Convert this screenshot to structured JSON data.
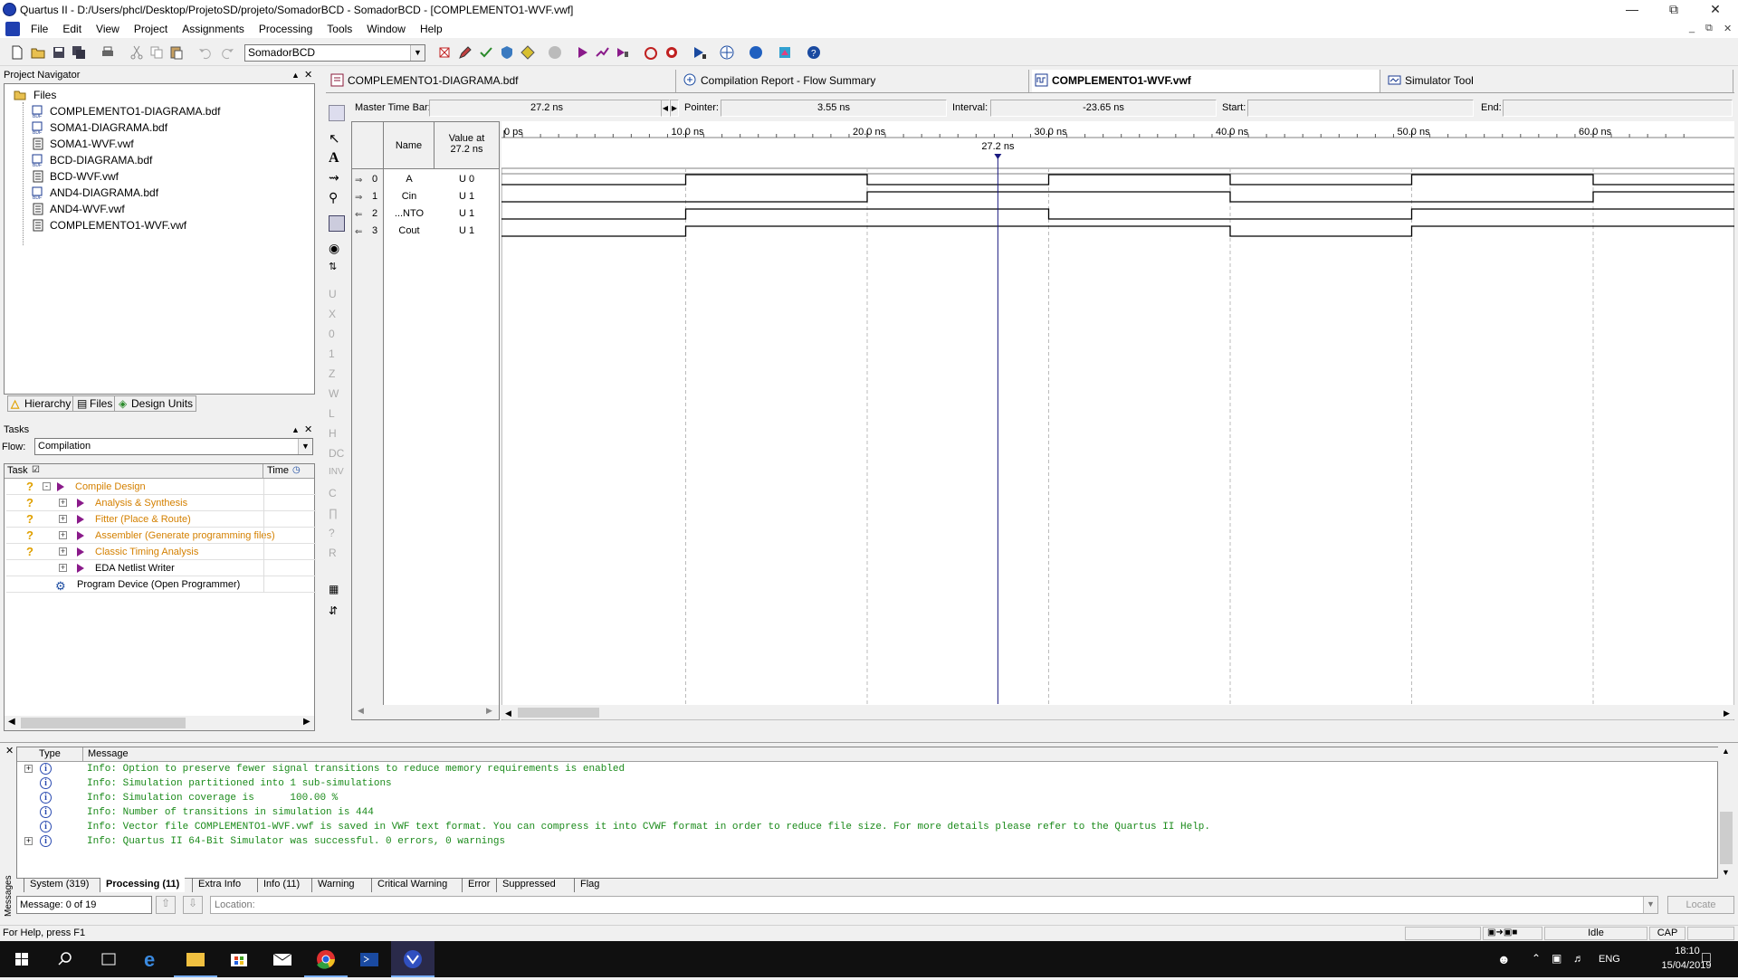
{
  "window": {
    "title": "Quartus II - D:/Users/phcl/Desktop/ProjetoSD/projeto/SomadorBCD - SomadorBCD - [COMPLEMENTO1-WVF.vwf]"
  },
  "menu": [
    "File",
    "Edit",
    "View",
    "Project",
    "Assignments",
    "Processing",
    "Tools",
    "Window",
    "Help"
  ],
  "toolbar": {
    "project_select": "SomadorBCD"
  },
  "project_navigator": {
    "title": "Project Navigator",
    "root": "Files",
    "files": [
      "COMPLEMENTO1-DIAGRAMA.bdf",
      "SOMA1-DIAGRAMA.bdf",
      "SOMA1-WVF.vwf",
      "BCD-DIAGRAMA.bdf",
      "BCD-WVF.vwf",
      "AND4-DIAGRAMA.bdf",
      "AND4-WVF.vwf",
      "COMPLEMENTO1-WVF.vwf"
    ],
    "tabs": [
      "Hierarchy",
      "Files",
      "Design Units"
    ]
  },
  "tasks": {
    "title": "Tasks",
    "flow_label": "Flow:",
    "flow_value": "Compilation",
    "col_task": "Task",
    "col_time": "Time",
    "rows": [
      "Compile Design",
      "Analysis & Synthesis",
      "Fitter (Place & Route)",
      "Assembler (Generate programming files)",
      "Classic Timing Analysis",
      "EDA Netlist Writer",
      "Program Device (Open Programmer)"
    ]
  },
  "doc_tabs": [
    "COMPLEMENTO1-DIAGRAMA.bdf",
    "Compilation Report - Flow Summary",
    "COMPLEMENTO1-WVF.vwf",
    "Simulator Tool"
  ],
  "waveform": {
    "master_label": "Master Time Bar:",
    "master_value": "27.2 ns",
    "pointer_label": "Pointer:",
    "pointer_value": "3.55 ns",
    "interval_label": "Interval:",
    "interval_value": "-23.65 ns",
    "start_label": "Start:",
    "end_label": "End:",
    "col_name": "Name",
    "col_value": "Value at",
    "col_value2": "27.2 ns",
    "cursor_label": "27.2 ns",
    "time_ticks": [
      "0 ps",
      "10.0 ns",
      "20.0 ns",
      "30.0 ns",
      "40.0 ns",
      "50.0 ns",
      "60.0 ns"
    ],
    "signals": [
      {
        "idx": "0",
        "name": "A",
        "value": "U 0",
        "transitions_ns": [
          0,
          10,
          20,
          30,
          40,
          50,
          60
        ],
        "start": 0
      },
      {
        "idx": "1",
        "name": "Cin",
        "value": "U 1",
        "transitions_ns": [
          0,
          20,
          40,
          60
        ],
        "start": 0
      },
      {
        "idx": "2",
        "name": "...NTO",
        "value": "U 1",
        "transitions_ns": [
          0,
          10,
          30,
          50
        ],
        "start": 0
      },
      {
        "idx": "3",
        "name": "Cout",
        "value": "U 1",
        "transitions_ns": [
          0,
          10,
          40,
          50
        ],
        "start": 0
      }
    ]
  },
  "messages": {
    "col_type": "Type",
    "col_message": "Message",
    "lines": [
      "Info: Option to preserve fewer signal transitions to reduce memory requirements is enabled",
      "Info: Simulation partitioned into 1 sub-simulations",
      "Info: Simulation coverage is      100.00 %",
      "Info: Number of transitions in simulation is 444",
      "Info: Vector file COMPLEMENTO1-WVF.vwf is saved in VWF text format. You can compress it into CVWF format in order to reduce file size. For more details please refer to the Quartus II Help.",
      "Info: Quartus II 64-Bit Simulator was successful. 0 errors, 0 warnings"
    ],
    "tabs": [
      "System (319)",
      "Processing (11)",
      "Extra Info",
      "Info (11)",
      "Warning",
      "Critical Warning",
      "Error",
      "Suppressed",
      "Flag"
    ],
    "side_label": "Messages",
    "count": "Message: 0 of 19",
    "location_label": "Location:",
    "locate_button": "Locate"
  },
  "statusbar": {
    "help": "For Help, press F1",
    "state": "Idle",
    "caps": "CAP"
  },
  "taskbar": {
    "lang": "ENG",
    "time": "18:10",
    "date": "15/04/2019"
  }
}
